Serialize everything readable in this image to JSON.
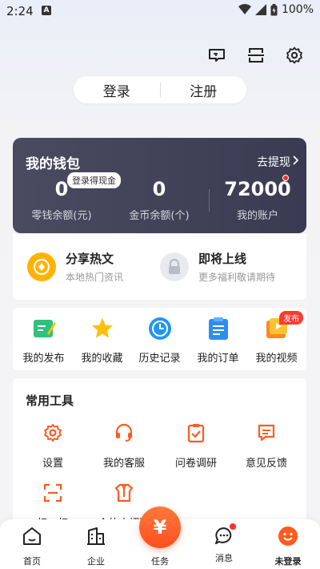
{
  "status_bar": {
    "time": "2:24",
    "notif_letter": "A",
    "battery": "100%"
  },
  "auth": {
    "login": "登录",
    "register": "注册"
  },
  "wallet": {
    "title": "我的钱包",
    "withdraw": "去提现",
    "login_tag": "登录得现金",
    "items": [
      {
        "value": "0",
        "label": "零钱余额(元)"
      },
      {
        "value": "0",
        "label": "金币余额(个)"
      },
      {
        "value": "72000",
        "label": "我的账户"
      }
    ]
  },
  "share": [
    {
      "title": "分享热文",
      "sub": "本地热门资讯"
    },
    {
      "title": "即将上线",
      "sub": "更多福利敬请期待"
    }
  ],
  "publish": {
    "items": [
      {
        "label": "我的发布",
        "icon": "edit-note-icon"
      },
      {
        "label": "我的收藏",
        "icon": "star-icon"
      },
      {
        "label": "历史记录",
        "icon": "clock-icon"
      },
      {
        "label": "我的订单",
        "icon": "order-list-icon"
      },
      {
        "label": "我的视频",
        "icon": "video-icon"
      }
    ],
    "video_badge": "发布"
  },
  "tools": {
    "title": "常用工具",
    "items": [
      {
        "label": "设置",
        "icon": "gear-icon"
      },
      {
        "label": "我的客服",
        "icon": "headset-icon"
      },
      {
        "label": "问卷调研",
        "icon": "clipboard-check-icon"
      },
      {
        "label": "意见反馈",
        "icon": "feedback-icon"
      },
      {
        "label": "扫一扫",
        "icon": "scan-icon"
      },
      {
        "label": "个体人招聘",
        "icon": "recruit-icon"
      }
    ]
  },
  "nav": {
    "home": "首页",
    "company": "企业",
    "task": "任务",
    "task_symbol": "¥",
    "message": "消息",
    "not_logged": "未登录"
  },
  "colors": {
    "accent": "#ff5a1f",
    "wallet_bg": "#3e3e55",
    "tool_icon": "#ff5a1f"
  }
}
